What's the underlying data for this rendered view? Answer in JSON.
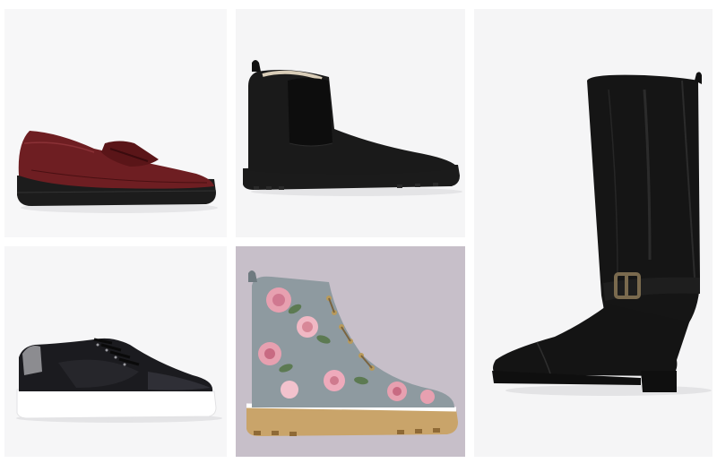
{
  "gallery": {
    "items": [
      {
        "id": "burgundy-loafer",
        "description_icon": "loafer-image",
        "colors": {
          "upper": "#6e1e22",
          "sole": "#1c1c1c"
        }
      },
      {
        "id": "black-suede-chelsea-boot",
        "description_icon": "chelsea-boot-image",
        "colors": {
          "upper": "#1a1a1a",
          "sole": "#111111"
        }
      },
      {
        "id": "black-knee-high-riding-boot",
        "description_icon": "riding-boot-image",
        "colors": {
          "upper": "#141414",
          "buckle": "#7a6a4e"
        }
      },
      {
        "id": "black-platform-sneaker",
        "description_icon": "sneaker-image",
        "colors": {
          "upper": "#1b1b1f",
          "sole": "#ffffff",
          "heel_tab": "#8c8c90"
        }
      },
      {
        "id": "floral-lace-up-boot",
        "description_icon": "floral-boot-image",
        "colors": {
          "background": "#c7bfc9",
          "base": "#8e9aa0",
          "rose": "#e7a0b0",
          "sole": "#c9a46a"
        }
      }
    ]
  }
}
